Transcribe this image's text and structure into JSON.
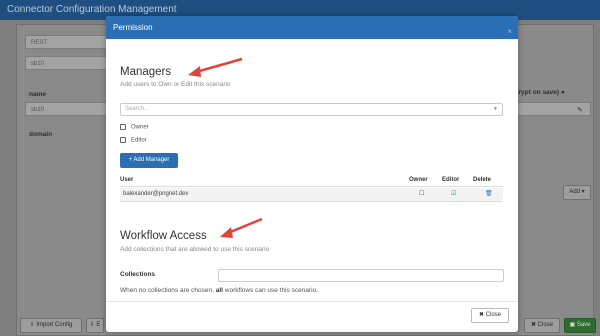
{
  "app": {
    "title": "Connector Configuration Management",
    "fields": [
      {
        "value": "REST"
      },
      {
        "value": "sb10"
      }
    ],
    "labels": {
      "name": "name",
      "domain": "domain",
      "encrypt": "crypt on save)"
    },
    "name_value": "sb10",
    "buttons": {
      "import_config": "Import Config",
      "export_initial": "E",
      "add": "Add",
      "close": "Close",
      "save": "Save"
    }
  },
  "modal": {
    "title": "Permission",
    "managers": {
      "heading": "Managers",
      "subtitle": "Add users to Own or Edit this scenario",
      "search_placeholder": "Search...",
      "roles": [
        "Owner",
        "Editor"
      ],
      "add_button": "+ Add Manager",
      "columns": {
        "user": "User",
        "owner": "Owner",
        "editor": "Editor",
        "delete": "Delete"
      },
      "rows": [
        {
          "user": "balexander@pngnet.dev"
        }
      ]
    },
    "workflow": {
      "heading": "Workflow Access",
      "subtitle": "Add collections that are allowed to use this scenario",
      "collections_label": "Collections",
      "help_prefix": "When no collections are chosen, ",
      "help_bold": "all",
      "help_suffix": " workflows can use this scenario."
    },
    "close_button": "Close"
  },
  "colors": {
    "header_blue": "#2a6fb5",
    "arrow_red": "#e0453a",
    "editor_green": "#3a9a3a",
    "delete_blue": "#2a6fb5"
  }
}
